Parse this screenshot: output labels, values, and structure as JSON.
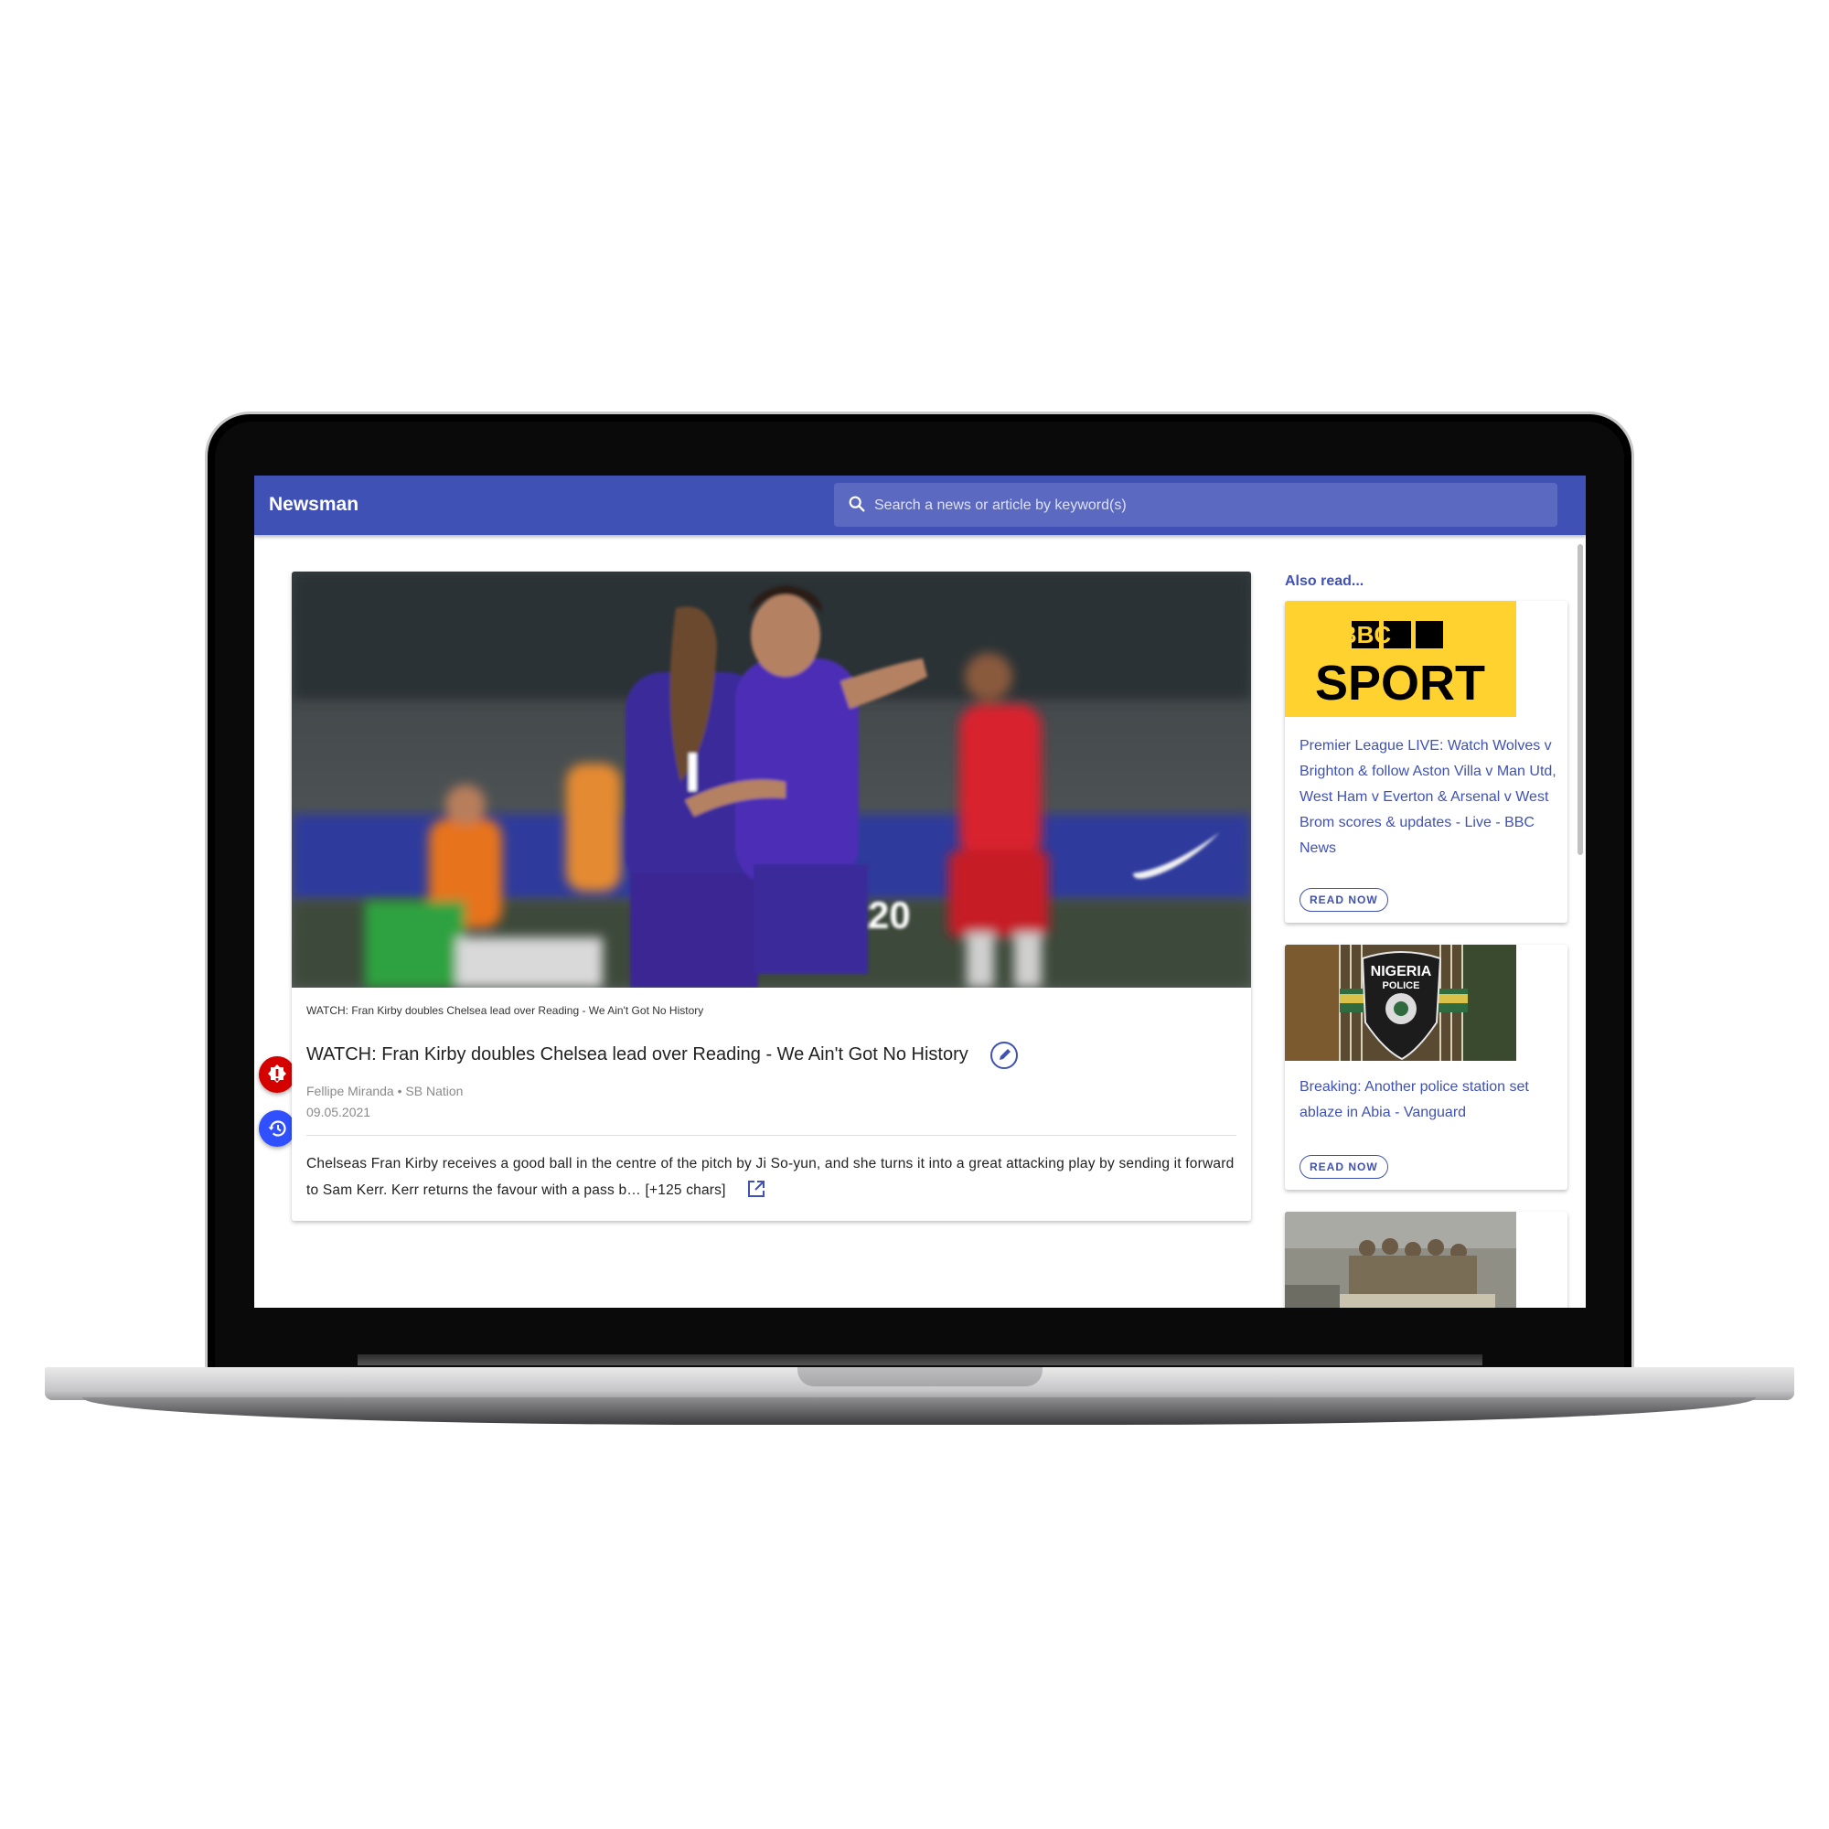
{
  "app": {
    "brand": "Newsman",
    "search": {
      "placeholder": "Search a news or article by keyword(s)"
    }
  },
  "article": {
    "caption": "WATCH: Fran Kirby doubles Chelsea lead over Reading - We Ain't Got No History",
    "title": "WATCH: Fran Kirby doubles Chelsea lead over Reading - We Ain't Got No History",
    "byline": "Fellipe Miranda • SB Nation",
    "date": "09.05.2021",
    "description": "Chelseas Fran Kirby receives a good ball in the centre of the pitch by Ji So-yun, and she turns it into a great attacking play by sending it forward to Sam Kerr. Kerr returns the favour with a pass b… [+125 chars]",
    "hero_image": "football-players-celebrating-photo"
  },
  "fab": {
    "report_icon": "alert-badge-icon",
    "history_icon": "history-icon",
    "report_color": "#d50000",
    "history_color": "#304ffe"
  },
  "sidebar": {
    "heading": "Also read...",
    "items": [
      {
        "title": "Premier League LIVE: Watch Wolves v Brighton & follow Aston Villa v Man Utd, West Ham v Everton & Arsenal v West Brom scores & updates - Live - BBC News",
        "button": "READ NOW",
        "thumb": "bbc-sport-logo",
        "logo_top": "BBC",
        "logo_bottom": "SPORT"
      },
      {
        "title": "Breaking: Another police station set ablaze in Abia - Vanguard",
        "button": "READ NOW",
        "thumb": "nigeria-police-badge-photo",
        "logo_top": "NIGERIA",
        "logo_bottom": "POLICE"
      },
      {
        "title": "",
        "button": "",
        "thumb": "soldiers-on-truck-photo"
      }
    ]
  },
  "colors": {
    "primary": "#3f51b5",
    "bbc_yellow": "#ffd230"
  }
}
